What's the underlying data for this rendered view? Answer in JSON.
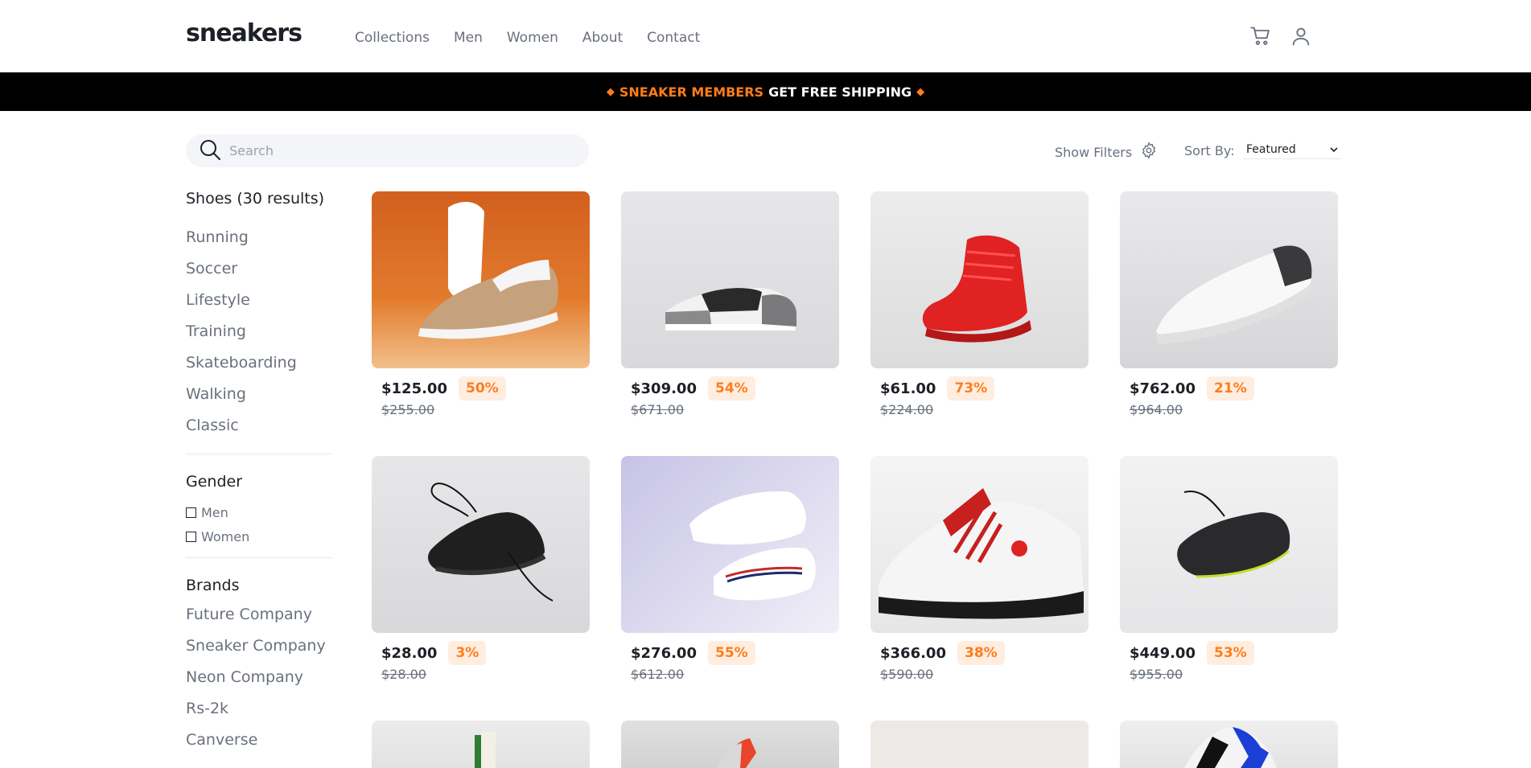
{
  "header": {
    "logo": "sneakers",
    "nav": [
      "Collections",
      "Men",
      "Women",
      "About",
      "Contact"
    ],
    "icons": [
      "cart-icon",
      "user-icon"
    ]
  },
  "banner": {
    "highlight": "SNEAKER MEMBERS",
    "rest": "GET FREE SHIPPING"
  },
  "toolbar": {
    "search_placeholder": "Search",
    "show_filters": "Show Filters",
    "sort_label": "Sort By:",
    "sort_value": "Featured"
  },
  "sidebar": {
    "title": "Shoes (30 results)",
    "categories": [
      "Running",
      "Soccer",
      "Lifestyle",
      "Training",
      "Skateboarding",
      "Walking",
      "Classic"
    ],
    "gender_title": "Gender",
    "genders": [
      "Men",
      "Women"
    ],
    "brands_title": "Brands",
    "brands": [
      "Future Company",
      "Sneaker Company",
      "Neon Company",
      "Rs-2k",
      "Canverse"
    ]
  },
  "products": [
    {
      "price": "$125.00",
      "discount": "50%",
      "old_price": "$255.00"
    },
    {
      "price": "$309.00",
      "discount": "54%",
      "old_price": "$671.00"
    },
    {
      "price": "$61.00",
      "discount": "73%",
      "old_price": "$224.00"
    },
    {
      "price": "$762.00",
      "discount": "21%",
      "old_price": "$964.00"
    },
    {
      "price": "$28.00",
      "discount": "3%",
      "old_price": "$28.00"
    },
    {
      "price": "$276.00",
      "discount": "55%",
      "old_price": "$612.00"
    },
    {
      "price": "$366.00",
      "discount": "38%",
      "old_price": "$590.00"
    },
    {
      "price": "$449.00",
      "discount": "53%",
      "old_price": "$955.00"
    }
  ],
  "colors": {
    "accent": "#ff7d1a",
    "accent_light": "#ffede0",
    "text_dark": "#1d2026",
    "text_gray": "#69707d"
  }
}
